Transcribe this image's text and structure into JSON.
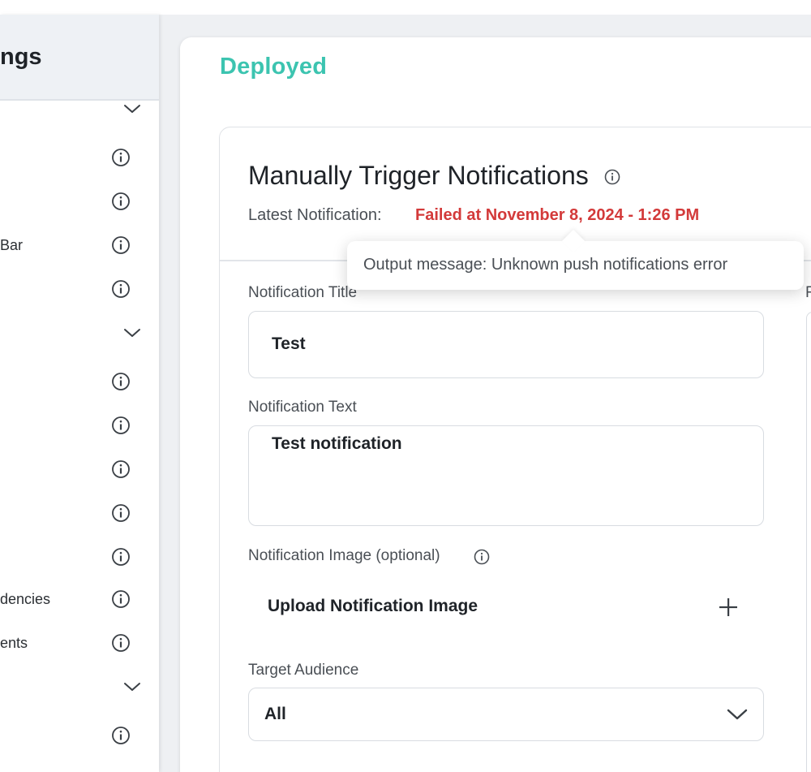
{
  "sidebar": {
    "title": "ngs",
    "rows": [
      {
        "label": "",
        "type": "chevron"
      },
      {
        "label": "",
        "type": "info"
      },
      {
        "label": "",
        "type": "info"
      },
      {
        "label": "Bar",
        "type": "info"
      },
      {
        "label": "",
        "type": "info"
      },
      {
        "label": "",
        "type": "chevron"
      },
      {
        "label": "",
        "type": "info"
      },
      {
        "label": "",
        "type": "info"
      },
      {
        "label": "",
        "type": "info"
      },
      {
        "label": "",
        "type": "info"
      },
      {
        "label": "",
        "type": "info"
      },
      {
        "label": "dencies",
        "type": "info"
      },
      {
        "label": "ents",
        "type": "info"
      },
      {
        "label": "",
        "type": "chevron"
      },
      {
        "label": "",
        "type": "info"
      }
    ]
  },
  "main": {
    "status": "Deployed",
    "section_title": "Manually Trigger Notifications",
    "latest_label": "Latest Notification:",
    "latest_status": "Failed at November 8, 2024 - 1:26 PM",
    "tooltip": "Output message: Unknown push notifications error",
    "fields": {
      "title_label": "Notification Title",
      "title_value": "Test",
      "text_label": "Notification Text",
      "text_value": "Test notification",
      "image_label": "Notification Image (optional)",
      "upload_label": "Upload Notification Image",
      "audience_label": "Target Audience",
      "audience_value": "All"
    },
    "right_label_fragment": "F"
  },
  "colors": {
    "deployed": "#3cc4b0",
    "error": "#d33a3a",
    "text": "#1f2328",
    "muted": "#4a4f55",
    "border": "#d8dce1"
  },
  "icons": {
    "info": "info-icon",
    "chevron": "chevron-down-icon",
    "plus": "plus-icon"
  }
}
